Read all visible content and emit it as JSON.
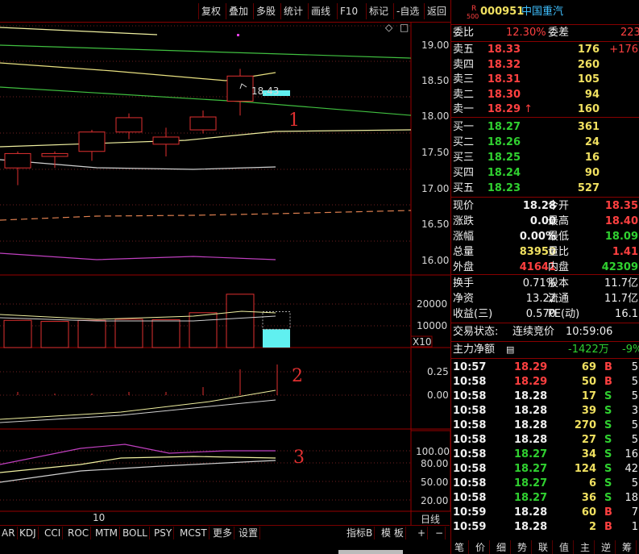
{
  "toolbar": {
    "buttons": [
      "复权",
      "叠加",
      "多股",
      "统计",
      "画线",
      "F10",
      "标记",
      "-自选",
      "返回"
    ]
  },
  "stock": {
    "r_label": "R",
    "market_label": "500",
    "code": "000951",
    "name": "中国重汽"
  },
  "chart": {
    "price_axis": [
      "19.00",
      "18.50",
      "18.00",
      "17.50",
      "17.00",
      "16.50",
      "16.00"
    ],
    "last_price_tag": "18.43",
    "volume_axis": [
      "20000",
      "10000"
    ],
    "volume_unit": "X10",
    "macd_axis": [
      "0.25",
      "0.00"
    ],
    "osc_axis": [
      "100.00",
      "80.00",
      "50.00",
      "20.00"
    ],
    "date_label": "10",
    "period": "日线",
    "annotation_1": "1",
    "annotation_2": "2",
    "annotation_3": "3",
    "candles": [
      {
        "o": 17.02,
        "h": 17.25,
        "l": 16.78,
        "c": 17.22
      },
      {
        "o": 17.18,
        "h": 17.25,
        "l": 17.02,
        "c": 17.22
      },
      {
        "o": 17.25,
        "h": 17.55,
        "l": 17.12,
        "c": 17.52
      },
      {
        "o": 17.52,
        "h": 17.78,
        "l": 17.42,
        "c": 17.72
      },
      {
        "o": 17.45,
        "h": 17.58,
        "l": 17.18,
        "c": 17.35
      },
      {
        "o": 17.55,
        "h": 17.82,
        "l": 17.5,
        "c": 17.73
      },
      {
        "o": 17.95,
        "h": 18.4,
        "l": 17.75,
        "c": 18.3
      }
    ],
    "volumes": [
      12500,
      12000,
      12500,
      13000,
      12800,
      16000,
      24500
    ],
    "current_volume": 8395
  },
  "bottom_tabs": [
    "AR",
    "KDJ",
    "CCI",
    "ROC",
    "MTM",
    "BOLL",
    "PSY",
    "MCST",
    "更多",
    "设置"
  ],
  "bottom_right_tabs": [
    "指标B",
    "模 板",
    "+",
    "−"
  ],
  "panel": {
    "weibi_label": "委比",
    "weibi_value": "12.30%",
    "weicha_label": "委差",
    "weicha_value": "223",
    "asks": [
      {
        "label": "卖五",
        "price": "18.33",
        "vol": "176",
        "chg": "+176"
      },
      {
        "label": "卖四",
        "price": "18.32",
        "vol": "260",
        "chg": ""
      },
      {
        "label": "卖三",
        "price": "18.31",
        "vol": "105",
        "chg": ""
      },
      {
        "label": "卖二",
        "price": "18.30",
        "vol": "94",
        "chg": ""
      },
      {
        "label": "卖一",
        "price": "18.29",
        "vol": "160",
        "chg": "↑"
      }
    ],
    "bids": [
      {
        "label": "买一",
        "price": "18.27",
        "vol": "361"
      },
      {
        "label": "买二",
        "price": "18.26",
        "vol": "24"
      },
      {
        "label": "买三",
        "price": "18.25",
        "vol": "16"
      },
      {
        "label": "买四",
        "price": "18.24",
        "vol": "90"
      },
      {
        "label": "买五",
        "price": "18.23",
        "vol": "527"
      }
    ],
    "quote": [
      {
        "l1": "现价",
        "v1": "18.28",
        "l2": "今开",
        "v2": "18.35"
      },
      {
        "l1": "涨跌",
        "v1": "0.00",
        "l2": "最高",
        "v2": "18.40"
      },
      {
        "l1": "涨幅",
        "v1": "0.00%",
        "l2": "最低",
        "v2": "18.09"
      },
      {
        "l1": "总量",
        "v1": "83950",
        "l2": "量比",
        "v2": "1.41"
      },
      {
        "l1": "外盘",
        "v1": "41641",
        "l2": "内盘",
        "v2": "42309"
      }
    ],
    "fin": [
      {
        "l1": "换手",
        "v1": "0.71%",
        "l2": "股本",
        "v2": "11.7亿"
      },
      {
        "l1": "净资",
        "v1": "13.22",
        "l2": "流通",
        "v2": "11.7亿"
      },
      {
        "l1": "收益(三)",
        "v1": "0.570",
        "l2": "PE(动)",
        "v2": "16.1"
      }
    ],
    "status_label": "交易状态:",
    "status_value": "连续竞价",
    "status_time": "10:59:06",
    "net_label": "主力净额",
    "net_value": "-1422万",
    "net_pct": "-9%",
    "ticks": [
      {
        "t": "10:57",
        "p": "18.29",
        "v": "69",
        "s": "B",
        "n": "5"
      },
      {
        "t": "10:58",
        "p": "18.29",
        "v": "50",
        "s": "B",
        "n": "5"
      },
      {
        "t": "10:58",
        "p": "18.28",
        "v": "17",
        "s": "S",
        "n": "5"
      },
      {
        "t": "10:58",
        "p": "18.28",
        "v": "39",
        "s": "S",
        "n": "3"
      },
      {
        "t": "10:58",
        "p": "18.28",
        "v": "270",
        "s": "S",
        "n": "5"
      },
      {
        "t": "10:58",
        "p": "18.28",
        "v": "27",
        "s": "S",
        "n": "5"
      },
      {
        "t": "10:58",
        "p": "18.27",
        "v": "34",
        "s": "S",
        "n": "16"
      },
      {
        "t": "10:58",
        "p": "18.27",
        "v": "124",
        "s": "S",
        "n": "42"
      },
      {
        "t": "10:58",
        "p": "18.27",
        "v": "6",
        "s": "S",
        "n": "5"
      },
      {
        "t": "10:58",
        "p": "18.27",
        "v": "36",
        "s": "S",
        "n": "18"
      },
      {
        "t": "10:59",
        "p": "18.28",
        "v": "60",
        "s": "B",
        "n": "7"
      },
      {
        "t": "10:59",
        "p": "18.28",
        "v": "2",
        "s": "B",
        "n": "1"
      }
    ],
    "bottom_tabs": [
      "笔",
      "价",
      "细",
      "势",
      "联",
      "值",
      "主",
      "逆",
      "筹"
    ]
  }
}
